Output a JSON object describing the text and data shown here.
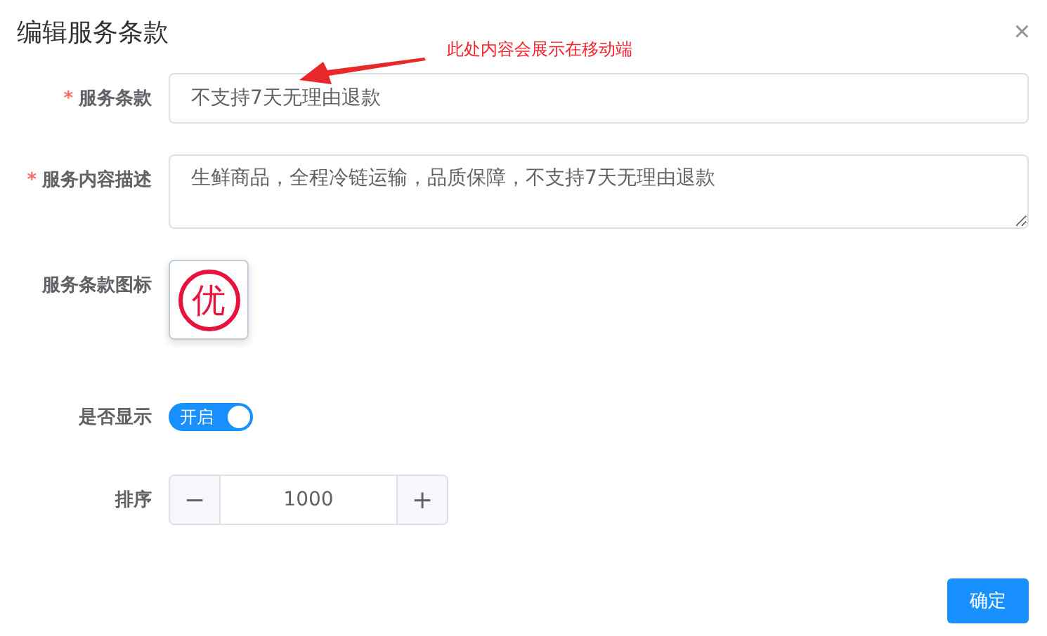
{
  "dialog": {
    "title": "编辑服务条款",
    "close": "×"
  },
  "annotation": {
    "text": "此处内容会展示在移动端"
  },
  "form": {
    "fields": [
      {
        "kind": "input",
        "required_mark": "*",
        "label": "服务条款",
        "value": "不支持7天无理由退款"
      },
      {
        "kind": "textarea",
        "required_mark": "*",
        "label": "服务内容描述",
        "value": "生鲜商品，全程冷链运输，品质保障，不支持7天无理由退款"
      },
      {
        "kind": "image",
        "label": "服务条款图标",
        "icon_text": "优"
      },
      {
        "kind": "switch",
        "label": "是否显示",
        "on": true,
        "on_text": "开启"
      },
      {
        "kind": "number",
        "label": "排序",
        "value": "1000",
        "minus": "−",
        "plus": "+"
      }
    ]
  },
  "buttons": [
    {
      "label": "确定"
    }
  ]
}
